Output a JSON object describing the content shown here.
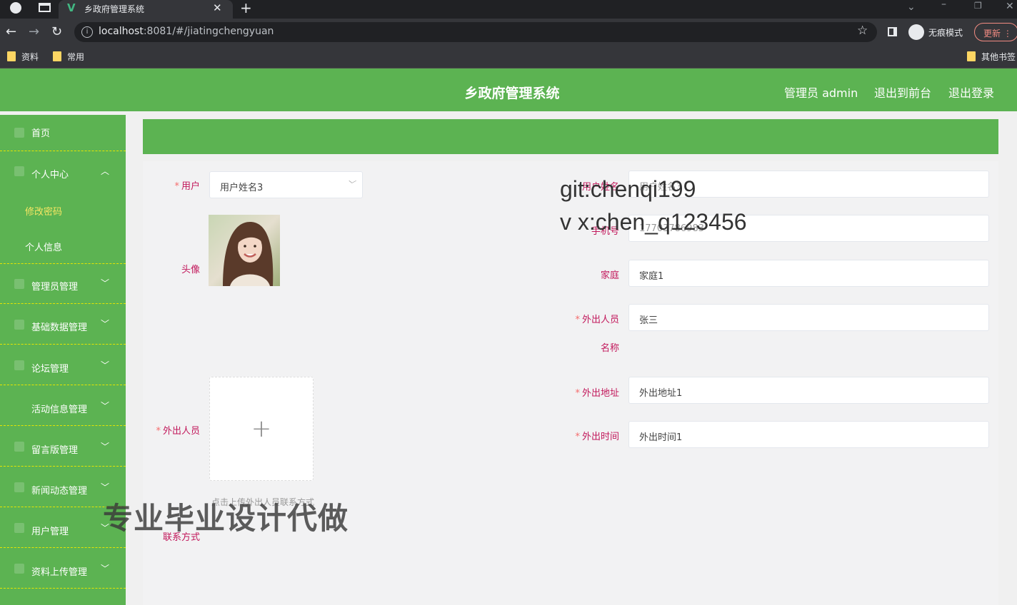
{
  "browser": {
    "tab_title": "乡政府管理系统",
    "url_host": "localhost",
    "url_rest": ":8081/#/jiatingchengyuan",
    "incognito_label": "无痕模式",
    "update_label": "更新",
    "bookmarks": [
      "资料",
      "常用",
      "其他书签"
    ]
  },
  "header": {
    "title": "乡政府管理系统",
    "admin_label": "管理员 admin",
    "to_front_label": "退出到前台",
    "logout_label": "退出登录"
  },
  "sidebar": {
    "items": [
      {
        "label": "首页"
      },
      {
        "label": "个人中心"
      },
      {
        "label": "修改密码"
      },
      {
        "label": "个人信息"
      },
      {
        "label": "管理员管理"
      },
      {
        "label": "基础数据管理"
      },
      {
        "label": "论坛管理"
      },
      {
        "label": "活动信息管理"
      },
      {
        "label": "留言版管理"
      },
      {
        "label": "新闻动态管理"
      },
      {
        "label": "用户管理"
      },
      {
        "label": "资料上传管理"
      }
    ],
    "active_sub_color": "#f5e663"
  },
  "form": {
    "user_label": "用户",
    "user_value": "用户姓名3",
    "avatar_label": "头像",
    "outgoing_person_photo_label": "外出人员",
    "upload_tip": "点击上传外出人员联系方式",
    "contact_label": "联系方式",
    "name_label": "用户姓名",
    "name_value": "用户姓名3",
    "phone_label": "手机号",
    "phone_value": "17703786983",
    "family_label": "家庭",
    "family_value": "家庭1",
    "outgoing_name_label_1": "外出人员",
    "outgoing_name_label_2": "名称",
    "outgoing_name_value": "张三",
    "address_label": "外出地址",
    "address_value": "外出地址1",
    "time_label": "外出时间",
    "time_value": "外出时间1"
  },
  "watermarks": {
    "git": "git:chenqi199",
    "vx": "v x:chen_q123456",
    "ad": "专业毕业设计代做"
  },
  "colors": {
    "brand_green": "#5cb352",
    "label_color": "#c2185b",
    "required_star": "#f56c6c"
  }
}
